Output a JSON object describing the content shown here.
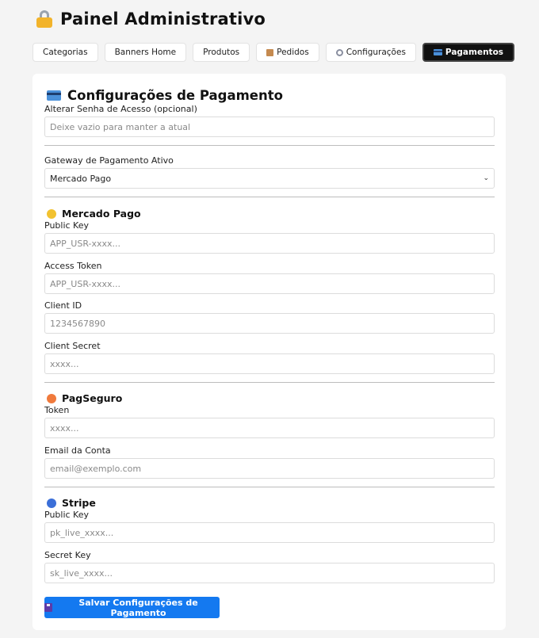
{
  "header": {
    "title": "Painel Administrativo",
    "icon": "lock-icon"
  },
  "tabs": [
    {
      "label": "Categorias",
      "icon": null,
      "active": false
    },
    {
      "label": "Banners Home",
      "icon": null,
      "active": false
    },
    {
      "label": "Produtos",
      "icon": null,
      "active": false
    },
    {
      "label": "Pedidos",
      "icon": "package-icon",
      "active": false
    },
    {
      "label": "Configurações",
      "icon": "gear-icon",
      "active": false
    },
    {
      "label": "Pagamentos",
      "icon": "credit-card-icon",
      "active": true
    }
  ],
  "panel": {
    "title": "Configurações de Pagamento",
    "password": {
      "label": "Alterar Senha de Acesso (opcional)",
      "placeholder": "Deixe vazio para manter a atual"
    },
    "gateway": {
      "label": "Gateway de Pagamento Ativo",
      "selected": "Mercado Pago"
    },
    "mercadopago": {
      "title": "Mercado Pago",
      "public_key_label": "Public Key",
      "public_key_placeholder": "APP_USR-xxxx...",
      "access_token_label": "Access Token",
      "access_token_placeholder": "APP_USR-xxxx...",
      "client_id_label": "Client ID",
      "client_id_placeholder": "1234567890",
      "client_secret_label": "Client Secret",
      "client_secret_placeholder": "xxxx..."
    },
    "pagseguro": {
      "title": "PagSeguro",
      "token_label": "Token",
      "token_placeholder": "xxxx...",
      "email_label": "Email da Conta",
      "email_placeholder": "email@exemplo.com"
    },
    "stripe": {
      "title": "Stripe",
      "public_key_label": "Public Key",
      "public_key_placeholder": "pk_live_xxxx...",
      "secret_key_label": "Secret Key",
      "secret_key_placeholder": "sk_live_xxxx..."
    },
    "save_label": "Salvar Configurações de Pagamento"
  },
  "colors": {
    "page_bg": "#f4f4f4",
    "accent": "#1479f0",
    "active_tab_bg": "#111111",
    "mercadopago_dot": "#f2c230",
    "pagseguro_dot": "#f07a3c",
    "stripe_dot": "#3b6fd8"
  }
}
